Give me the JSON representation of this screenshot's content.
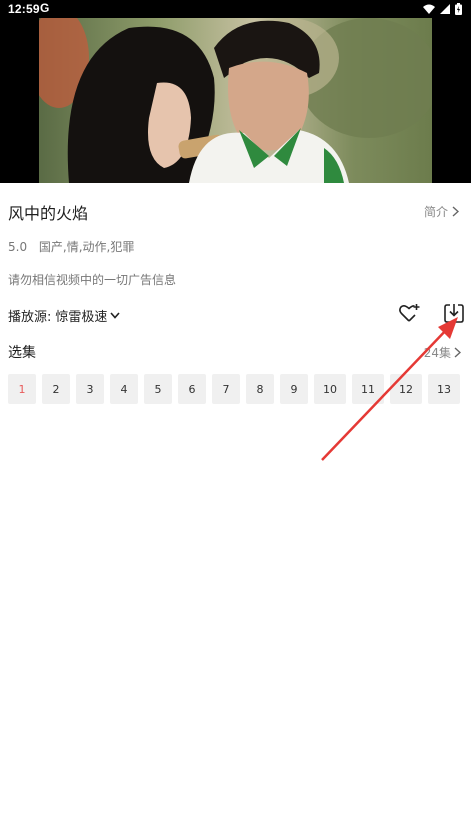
{
  "status_bar": {
    "time": "12:59",
    "carrier_icon": "G",
    "icons": [
      "wifi-icon",
      "signal-icon",
      "battery-icon"
    ]
  },
  "video": {
    "icon": "video-player"
  },
  "detail": {
    "title": "风中的火焰",
    "intro_label": "简介",
    "rating": "5.0",
    "genres": "国产,情,动作,犯罪",
    "notice": "请勿相信视频中的一切广告信息"
  },
  "source": {
    "label": "播放源:",
    "value": "惊雷极速"
  },
  "episodes": {
    "label": "选集",
    "count": "24集",
    "active_index": 0,
    "items": [
      "1",
      "2",
      "3",
      "4",
      "5",
      "6",
      "7",
      "8",
      "9",
      "10",
      "11",
      "12",
      "13"
    ]
  },
  "colors": {
    "accent": "#e85a5a",
    "arrow": "#e53935",
    "chip_bg": "#f0f0f0"
  }
}
